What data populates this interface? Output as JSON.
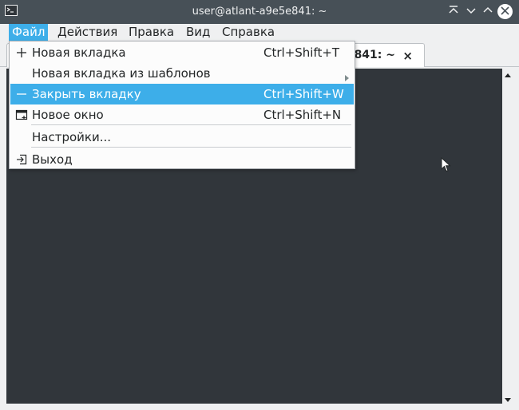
{
  "window": {
    "title": "user@atlant-a9e5e841: ~",
    "app_icon": "terminal-icon"
  },
  "titlebar_buttons": {
    "keep_above": "chevron-up-bar-icon",
    "minimize": "chevron-down-icon",
    "maximize": "chevron-up-icon",
    "close": "close-icon"
  },
  "menubar": {
    "items": [
      {
        "label": "Файл"
      },
      {
        "label": "Действия"
      },
      {
        "label": "Правка"
      },
      {
        "label": "Вид"
      },
      {
        "label": "Справка"
      }
    ],
    "active_index": 0
  },
  "tab": {
    "title": "841: ~",
    "close_label": "×"
  },
  "file_menu": {
    "items": [
      {
        "label": "Новая вкладка",
        "shortcut": "Ctrl+Shift+T",
        "icon": "plus-icon"
      },
      {
        "label": "Новая вкладка из шаблонов",
        "shortcut": "",
        "icon": "",
        "submenu": true
      },
      {
        "label": "Закрыть вкладку",
        "shortcut": "Ctrl+Shift+W",
        "icon": "minus-icon",
        "highlighted": true
      },
      {
        "label": "Новое окно",
        "shortcut": "Ctrl+Shift+N",
        "icon": "new-window-icon"
      },
      {
        "label": "Настройки...",
        "shortcut": "",
        "icon": ""
      },
      {
        "label": "Выход",
        "shortcut": "",
        "icon": "exit-icon"
      }
    ]
  },
  "colors": {
    "titlebar": "#475057",
    "accent": "#3daee9",
    "terminal_bg": "#31363b",
    "menu_bg": "#fcfcfc"
  }
}
